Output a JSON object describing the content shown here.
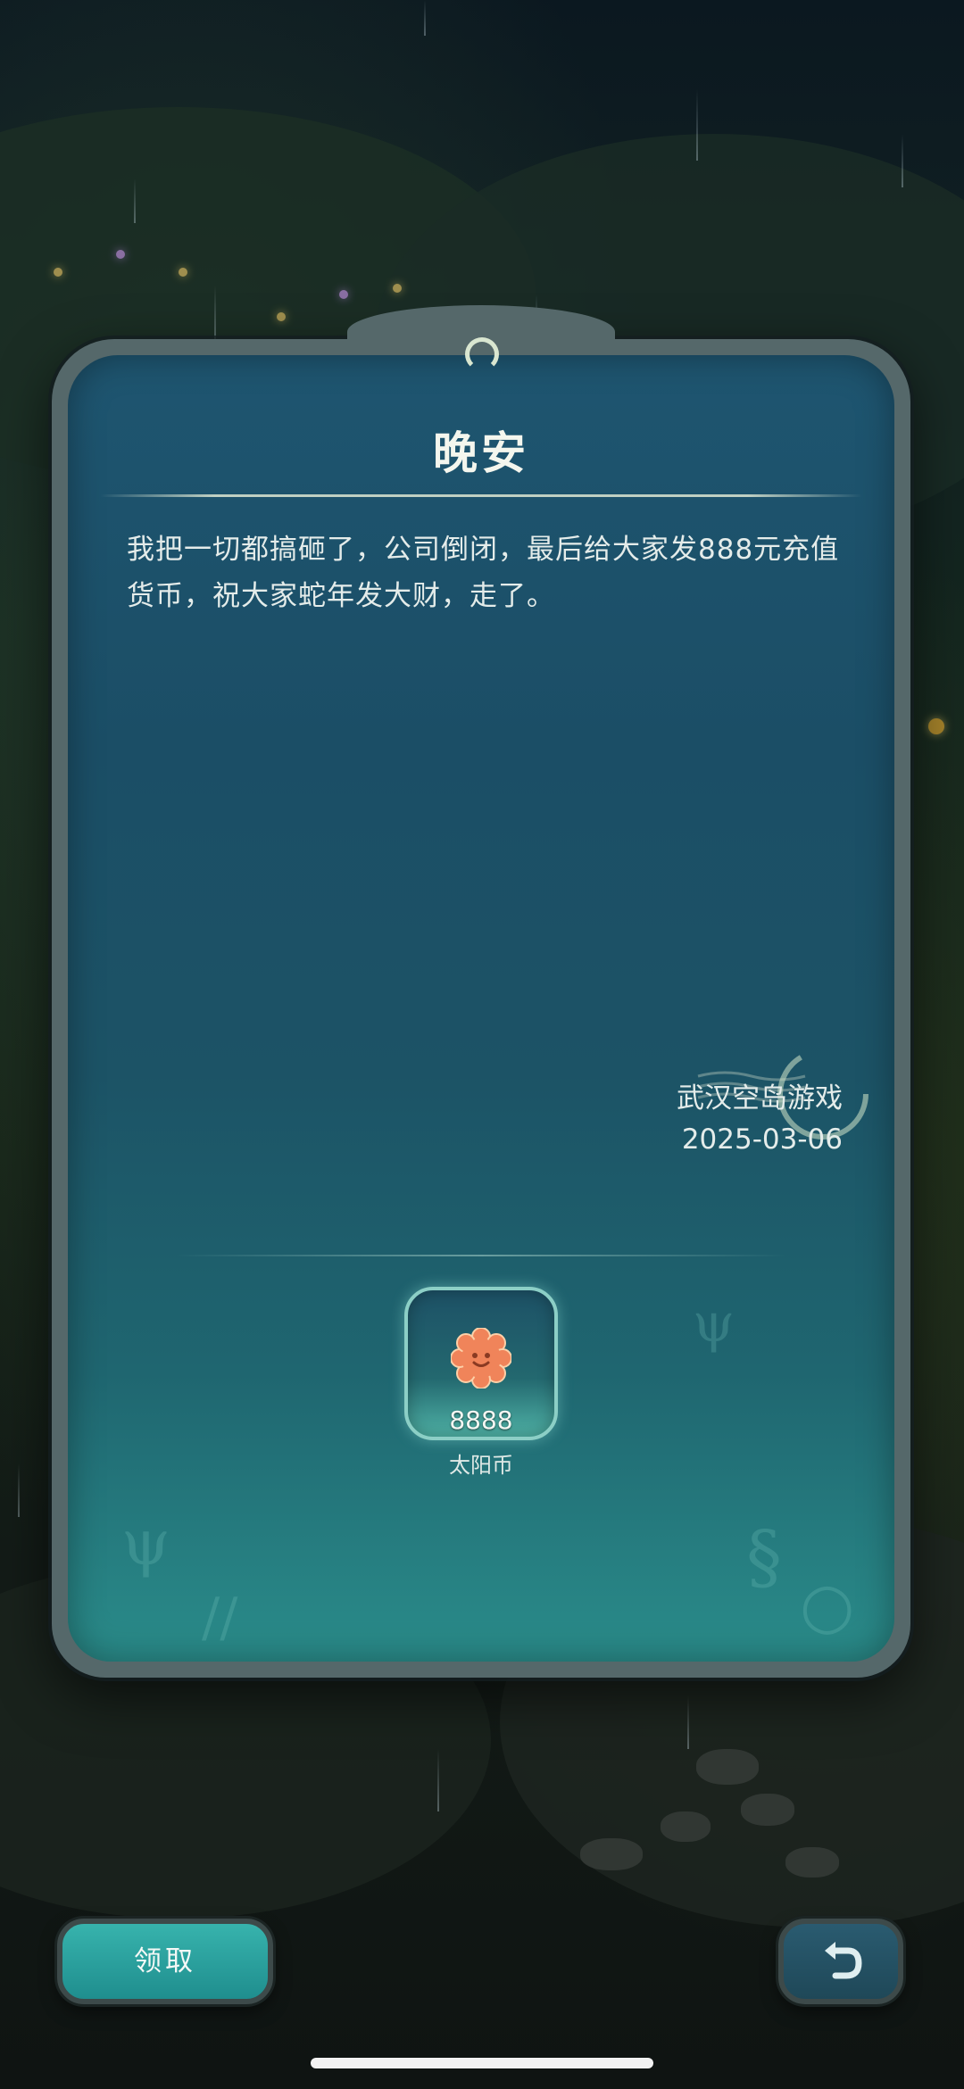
{
  "letter": {
    "title": "晚安",
    "body": "我把一切都搞砸了，公司倒闭，最后给大家发888元充值货币，祝大家蛇年发大财，走了。",
    "sender": "武汉空岛游戏",
    "date": "2025-03-06"
  },
  "reward": {
    "icon": "sun-coin-icon",
    "count": "8888",
    "name": "太阳币"
  },
  "actions": {
    "claim_label": "领取",
    "back_icon": "return-arrow-icon"
  },
  "colors": {
    "panel_top": "#1e5570",
    "panel_bottom": "#2a8c8a",
    "claim_button": "#37b3ad",
    "coin": "#f0845a"
  }
}
